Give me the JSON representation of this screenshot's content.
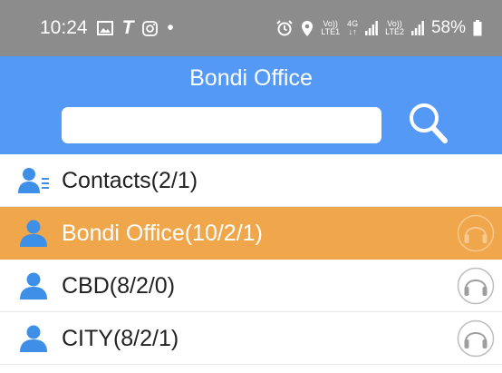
{
  "status_bar": {
    "time": "10:24",
    "t_glyph": "T",
    "dot": "•",
    "volte1_top": "Vo))",
    "volte1_bottom": "LTE1",
    "net_top": "4G",
    "net_bottom": "↓↑",
    "volte2_top": "Vo))",
    "volte2_bottom": "LTE2",
    "battery": "58%"
  },
  "header": {
    "title": "Bondi Office",
    "search": {
      "value": "",
      "placeholder": ""
    }
  },
  "list": [
    {
      "label": "Contacts(2/1)",
      "icon": "contacts-list-icon",
      "selected": false,
      "headset": false
    },
    {
      "label": "Bondi Office(10/2/1)",
      "icon": "group-person-icon",
      "selected": true,
      "headset": true
    },
    {
      "label": "CBD(8/2/0)",
      "icon": "group-person-icon",
      "selected": false,
      "headset": true
    },
    {
      "label": "CITY(8/2/1)",
      "icon": "group-person-icon",
      "selected": false,
      "headset": true
    }
  ],
  "colors": {
    "status_bar": "#8c8c8c",
    "header": "#5599f6",
    "selected_row": "#f0a64a",
    "person_icon": "#3d8fe8"
  }
}
